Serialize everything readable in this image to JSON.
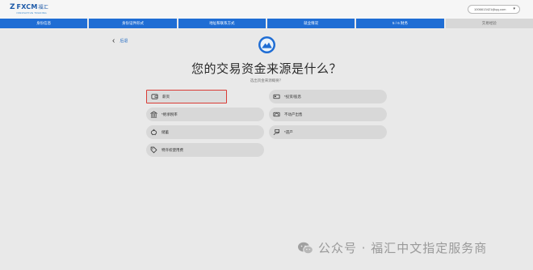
{
  "header": {
    "logo_mark": "Z",
    "logo_brand": "FXCM",
    "logo_cn": "福汇",
    "logo_tagline": "INNOVATIVE TRADING",
    "user_email": "1006613421@qq.com",
    "dropdown_caret": "▾"
  },
  "steps": [
    {
      "label": "身份信息"
    },
    {
      "label": "身份证件形式"
    },
    {
      "label": "地址和联系方式"
    },
    {
      "label": "就业情况"
    },
    {
      "label": "5 / 6  财务"
    },
    {
      "label": "交易经验"
    }
  ],
  "nav": {
    "back_label": "后退"
  },
  "question": {
    "title": "您的交易资金来源是什么？",
    "subtitle": "选出资金来源概要？"
  },
  "options": [
    {
      "label": "薪资",
      "icon": "wallet-icon",
      "selected": true
    },
    {
      "label": "*投资/股息",
      "icon": "card-icon",
      "selected": false
    },
    {
      "label": "*继承税率",
      "icon": "bank-icon",
      "selected": false
    },
    {
      "label": "不动产出售",
      "icon": "house-icon",
      "selected": false
    },
    {
      "label": "储蓄",
      "icon": "piggy-bank-icon",
      "selected": false
    },
    {
      "label": "*遗产",
      "icon": "cash-hand-icon",
      "selected": false
    },
    {
      "label": "特许权使用费",
      "icon": "tag-icon",
      "selected": false
    }
  ],
  "watermark": {
    "text": "公众号 · 福汇中文指定服务商"
  },
  "colors": {
    "accent_blue": "#1f6dd4",
    "selected_border": "#d93b35",
    "background": "#e9e9e9"
  }
}
